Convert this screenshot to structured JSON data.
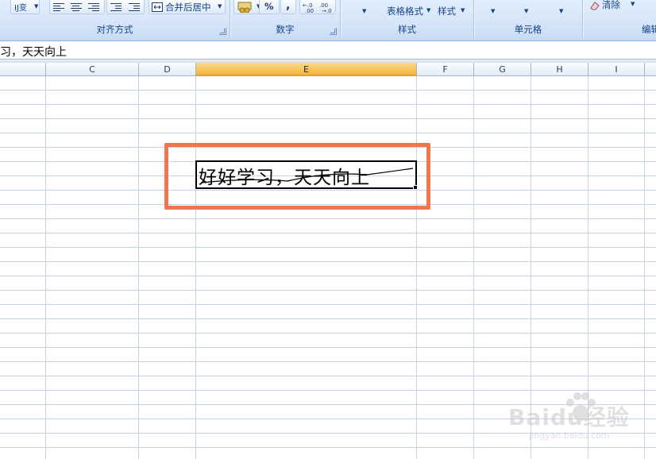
{
  "ribbon": {
    "wrap_text_label": "Ĳ变",
    "merge_center_label": "合并后居中",
    "percent_label": "%",
    "comma_label": ",",
    "table_format_label": "表格格式",
    "cell_style_label": "样式",
    "clear_label": "清除",
    "groups": {
      "alignment": "对齐方式",
      "number": "数字",
      "styles": "样式",
      "cells": "单元格",
      "editing": "编辑"
    }
  },
  "formula_bar": {
    "content": "习，天天向上"
  },
  "columns": [
    {
      "label": "C"
    },
    {
      "label": "D"
    },
    {
      "label": "E"
    },
    {
      "label": "F"
    },
    {
      "label": "G"
    },
    {
      "label": "H"
    },
    {
      "label": "I"
    }
  ],
  "active_column": "E",
  "cell": {
    "text": "好好学习，天天向上"
  },
  "watermark": {
    "brand": "Baidu经验",
    "url": "jingyan.baidu.com"
  },
  "colors": {
    "highlight": "#f2764d",
    "active_header": "#f3b53e",
    "ribbon": "#d6e6f8",
    "gridline": "#c5d3e3"
  }
}
